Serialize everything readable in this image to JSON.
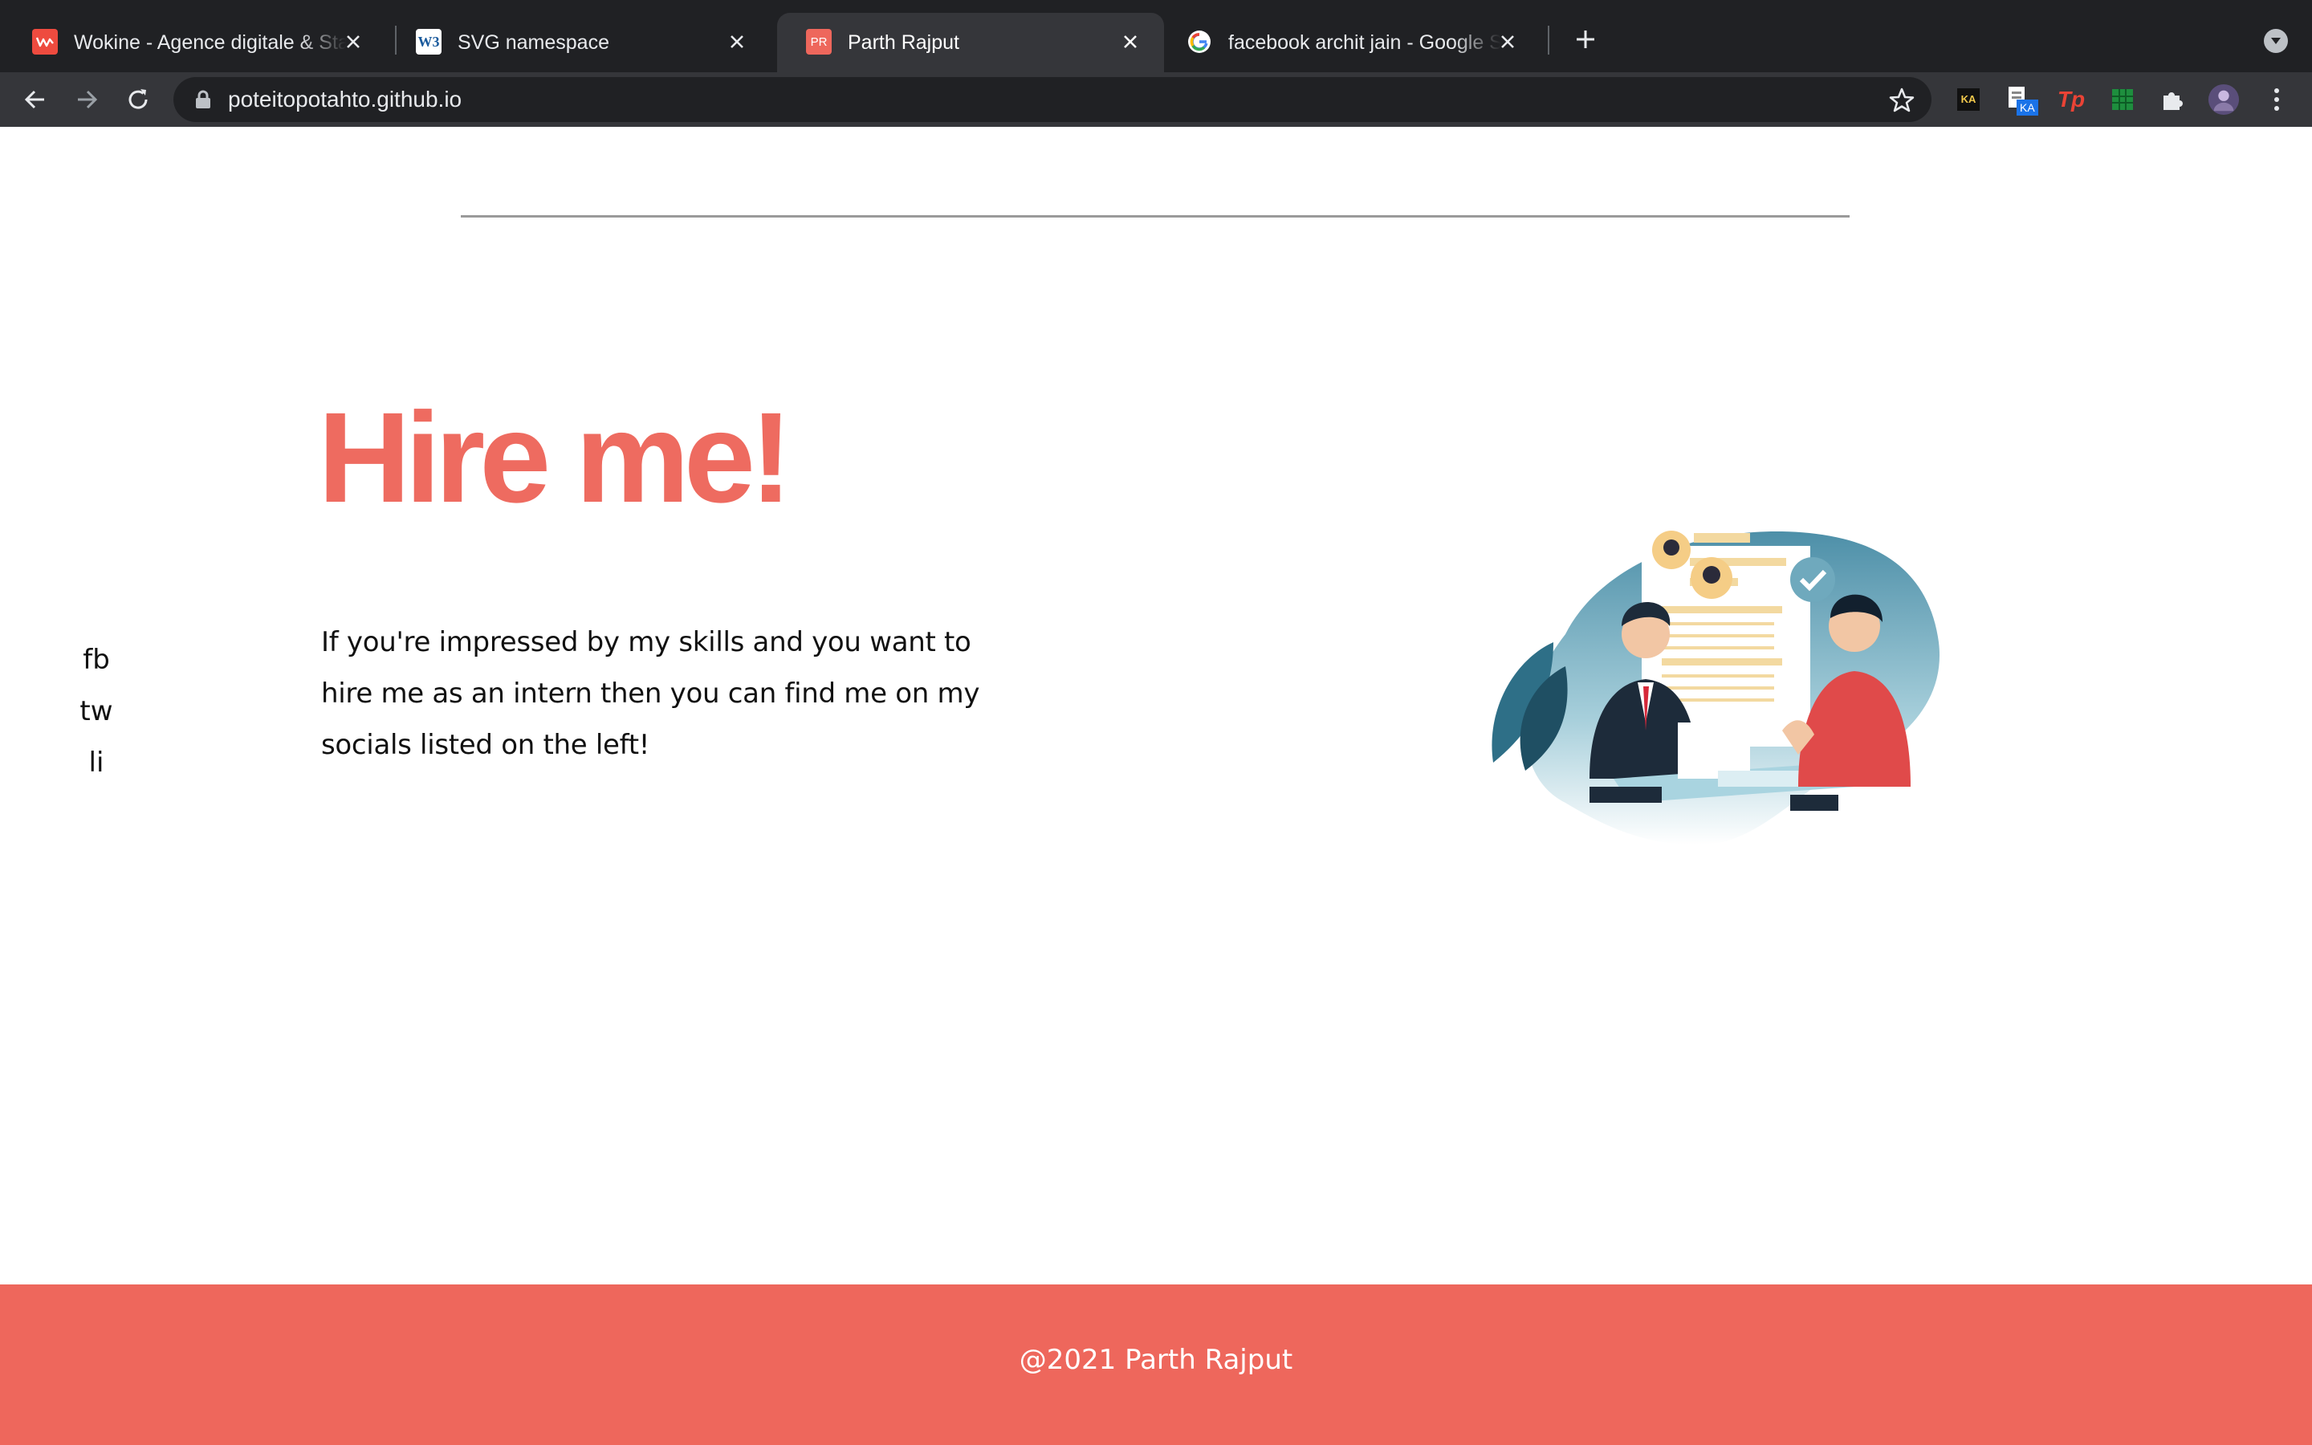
{
  "browser": {
    "tabs": [
      {
        "title": "Wokine - Agence digitale & Sta",
        "favicon": "wokine-logo-icon",
        "active": false
      },
      {
        "title": "SVG namespace",
        "favicon": "w3c-logo-icon",
        "active": false
      },
      {
        "title": "Parth Rajput",
        "favicon": "pr-logo-icon",
        "favicon_text": "PR",
        "active": true
      },
      {
        "title": "facebook archit jain - Google S",
        "favicon": "google-logo-icon",
        "active": false
      }
    ],
    "w3c_favicon_text": "W3",
    "url": "poteitopotahto.github.io",
    "extensions": [
      {
        "name": "ka-extension-icon",
        "text": "KA"
      },
      {
        "name": "ka-document-extension-icon",
        "badge": "KA"
      },
      {
        "name": "tp-extension-icon",
        "text": "Tp"
      },
      {
        "name": "grid-extension-icon"
      },
      {
        "name": "puzzle-extensions-icon"
      },
      {
        "name": "profile-avatar-icon"
      },
      {
        "name": "kebab-menu-icon"
      }
    ],
    "colors": {
      "frame": "#202124",
      "toolbar": "#35363a",
      "tab_text": "#e8eaed"
    }
  },
  "page": {
    "hero": {
      "title": "Hire me!",
      "body": "If you're impressed by my skills and you want to hire me as an intern then you can find me on my socials listed on the left!"
    },
    "socials": [
      "fb",
      "tw",
      "li"
    ],
    "footer": {
      "text": "@2021 Parth Rajput"
    },
    "colors": {
      "accent": "#ee6b60",
      "footer_bg": "#ee675c",
      "text": "#111111",
      "rule": "#9a9a9a"
    },
    "illustration": "job-interview-illustration"
  }
}
